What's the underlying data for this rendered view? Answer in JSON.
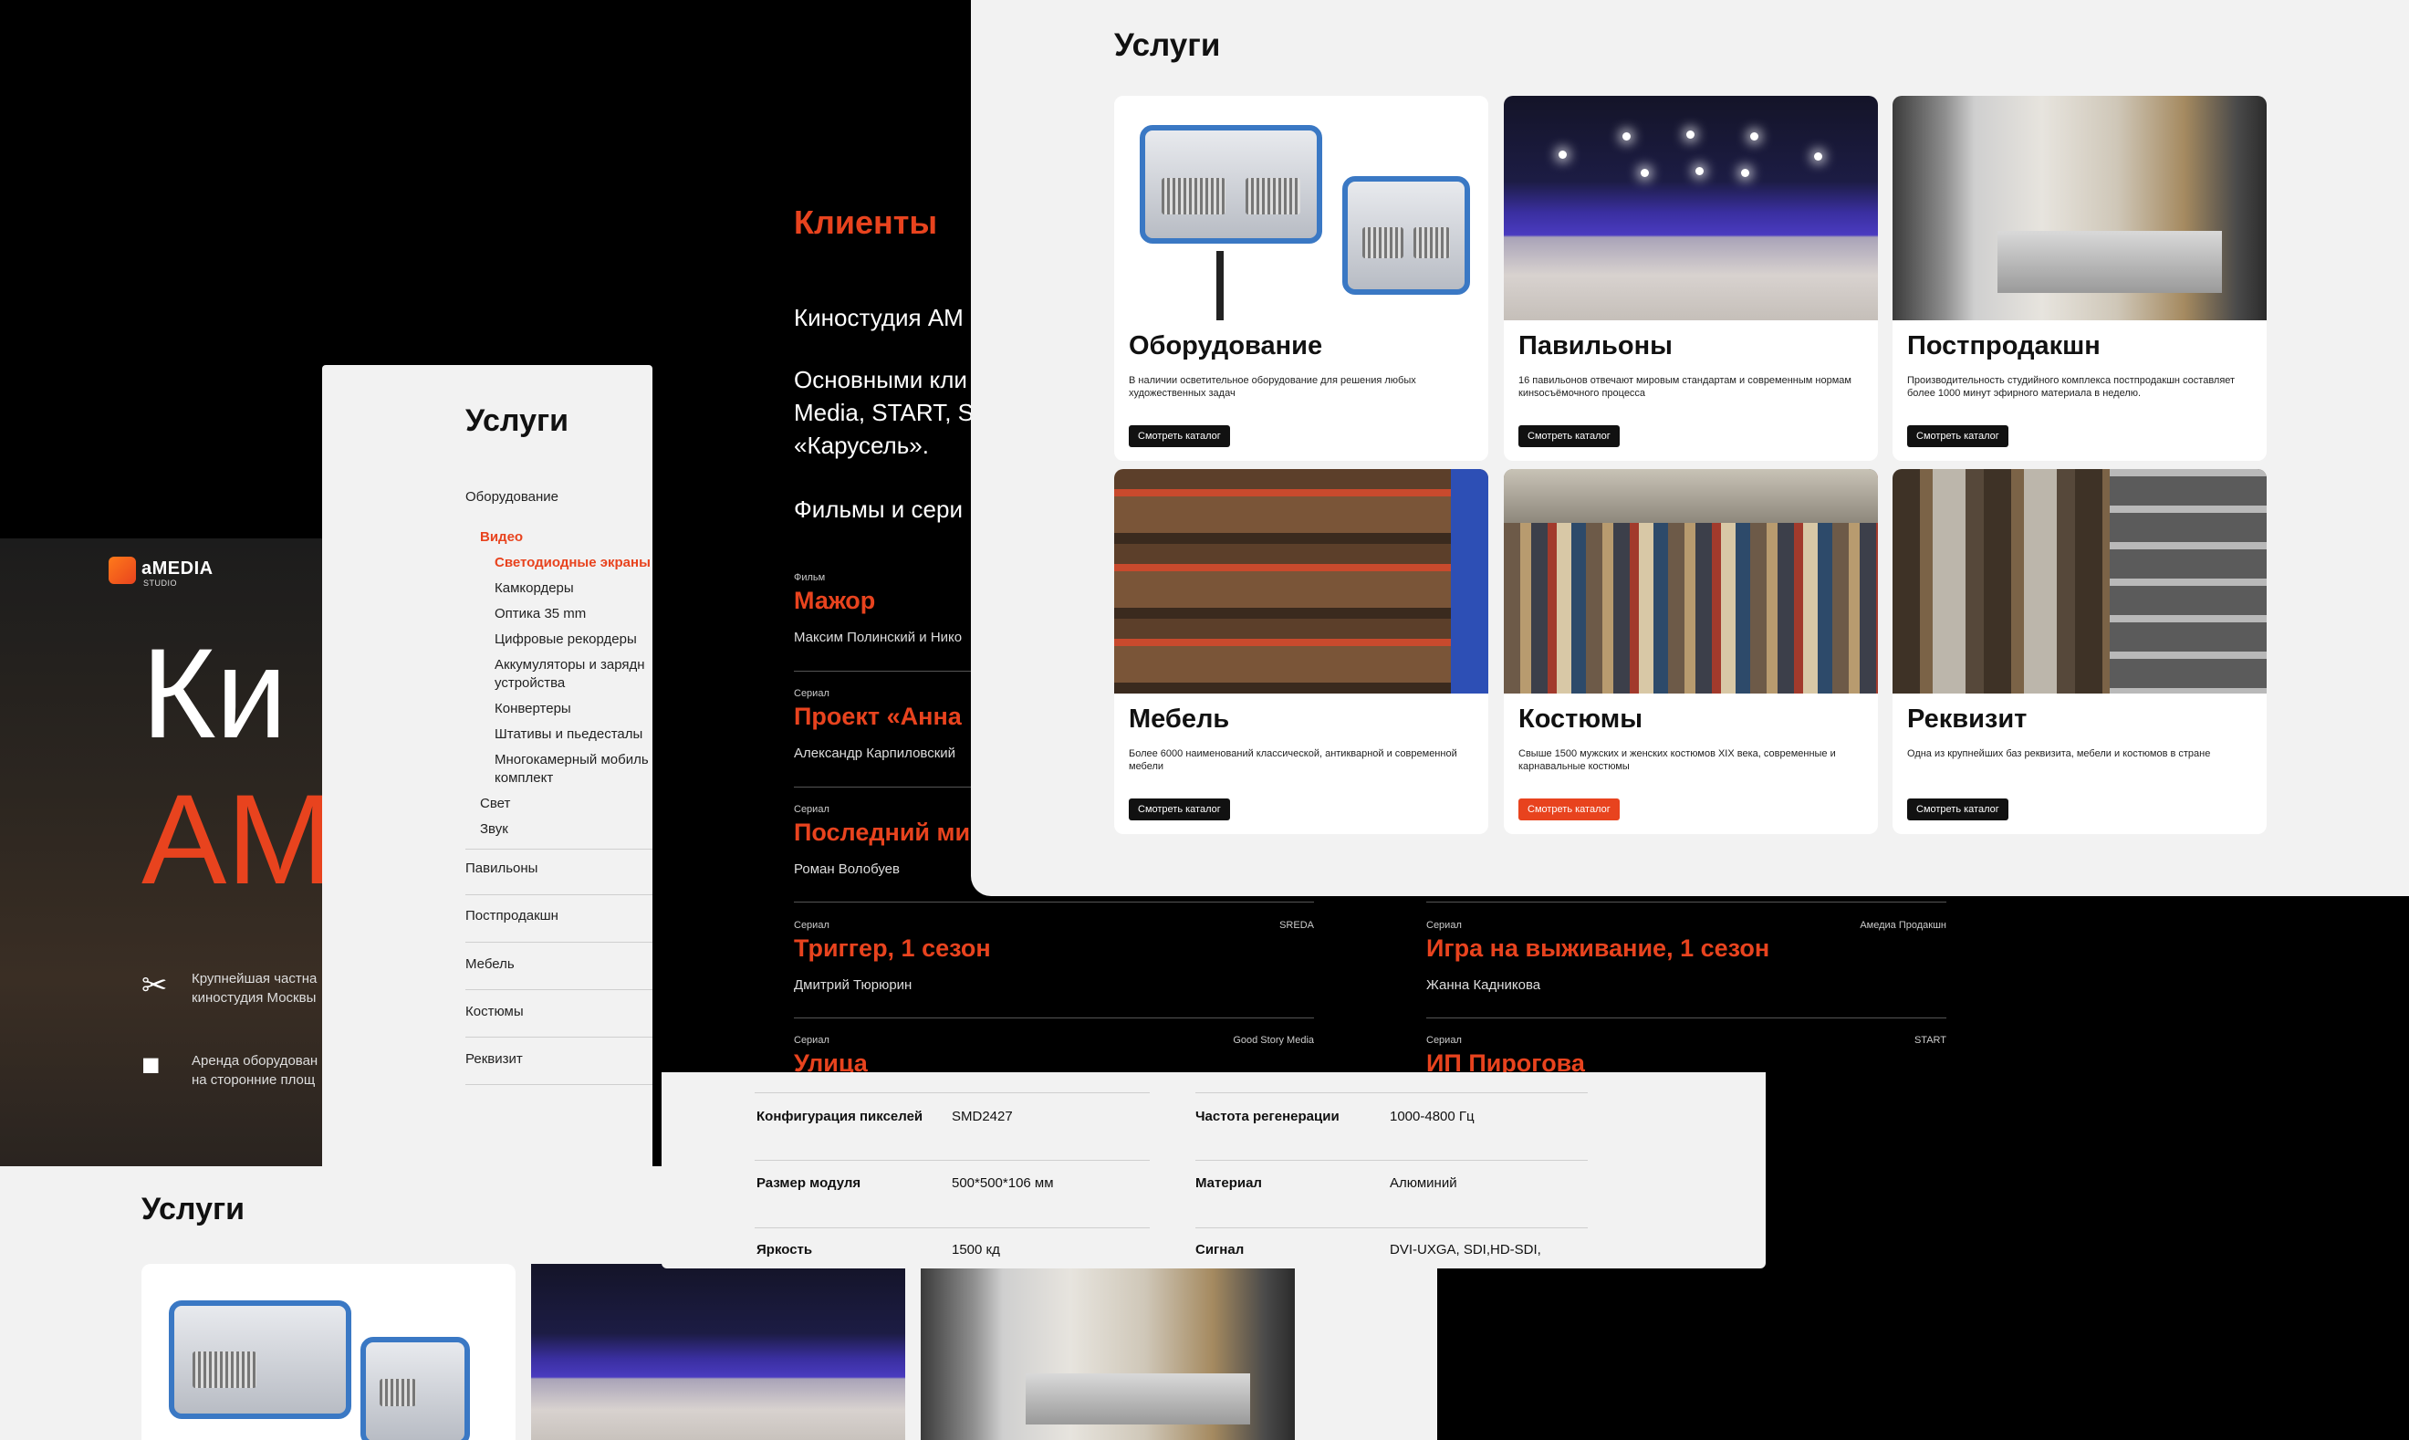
{
  "hero": {
    "logo": "aMEDIA",
    "logo_sub": "STUDIO",
    "headline_1": "Ки",
    "headline_2": "АМ",
    "features": [
      {
        "icon": "clapperboard-icon",
        "text": "Крупнейшая частна\nкиностудия Москвы"
      },
      {
        "icon": "camera-icon",
        "text": "Аренда оборудован\nна сторонние площ"
      }
    ]
  },
  "bottom_services": {
    "title": "Услуги"
  },
  "sidebar": {
    "title": "Услуги",
    "items": [
      {
        "label": "Оборудование"
      },
      {
        "label": "Видео"
      },
      {
        "label": "Светодиодные экраны"
      },
      {
        "label": "Камкордеры"
      },
      {
        "label": "Оптика 35 mm"
      },
      {
        "label": "Цифровые рекордеры"
      },
      {
        "label": "Аккумуляторы и зарядн"
      },
      {
        "label": "устройства"
      },
      {
        "label": "Конвертеры"
      },
      {
        "label": "Штативы и пьедесталы"
      },
      {
        "label": "Многокамерный мобиль"
      },
      {
        "label": "комплект"
      },
      {
        "label": "Свет"
      },
      {
        "label": "Звук"
      },
      {
        "label": "Павильоны"
      },
      {
        "label": "Постпродакшн"
      },
      {
        "label": "Мебель"
      },
      {
        "label": "Костюмы"
      },
      {
        "label": "Реквизит"
      }
    ]
  },
  "clients": {
    "title": "Клиенты",
    "para_1": "Киностудия АМ",
    "para_2_line1": "Основными кли",
    "para_2_line2": "Media, START, SI",
    "para_2_line3": "«Карусель».",
    "para_3": "Фильмы и сери",
    "items": [
      {
        "type": "Фильм",
        "name": "Мажор",
        "director": "Максим Полинский и Нико",
        "studio": ""
      },
      {
        "type": "Сериал",
        "name": "Проект «Анна",
        "director": "Александр Карпиловский",
        "studio": ""
      },
      {
        "type": "Сериал",
        "name": "Последний ми",
        "director": "Роман Волобуев",
        "studio": ""
      },
      {
        "type": "Сериал",
        "name": "Триггер, 1 сезон",
        "director": "Дмитрий Тюрюрин",
        "studio": "SREDA"
      },
      {
        "type": "Сериал",
        "name": "Игра на выживание, 1 сезон",
        "director": "Жанна Кадникова",
        "studio": "Амедиа Продакшн"
      },
      {
        "type": "Сериал",
        "name": "Улица",
        "director": "",
        "studio": "Good Story Media"
      },
      {
        "type": "Сериал",
        "name": "ИП Пирогова",
        "director": "",
        "studio": "START"
      }
    ]
  },
  "specs": {
    "rows": [
      {
        "l1": "Конфигурация пикселей",
        "v1": "SMD2427",
        "l2": "Частота регенерации",
        "v2": "1000-4800 Гц"
      },
      {
        "l1": "Размер модуля",
        "v1": "500*500*106 мм",
        "l2": "Материал",
        "v2": "Алюминий"
      },
      {
        "l1": "Яркость",
        "v1": "1500 кд",
        "l2": "Сигнал",
        "v2": "DVI-UXGA, SDI,HD-SDI,"
      }
    ]
  },
  "main": {
    "title": "Услуги",
    "cards": [
      {
        "title": "Оборудование",
        "desc": "В наличии осветительное оборудование для решения любых художественных задач",
        "button": "Смотреть каталог",
        "image": "equipment-photo"
      },
      {
        "title": "Павильоны",
        "desc": "16 павильонов отвечают мировым стандартам и современным нормам кинsocъёмочного процесса",
        "button": "Смотреть каталог",
        "image": "pavilion-photo"
      },
      {
        "title": "Постпродакшн",
        "desc": "Производительность студийного комплекса постпродакшн составляет более 1000 минут эфирного материала в неделю.",
        "button": "Смотреть каталог",
        "image": "postproduction-photo"
      },
      {
        "title": "Мебель",
        "desc": "Более 6000 наименований классической, антикварной и современной мебели",
        "button": "Смотреть каталог",
        "image": "furniture-photo"
      },
      {
        "title": "Костюмы",
        "desc": "Свыше 1500 мужских и женских костюмов XIX века, современные и карнавальные костюмы",
        "button": "Смотреть каталог",
        "image": "costumes-photo"
      },
      {
        "title": "Реквизит",
        "desc": "Одна из крупнейших баз реквизита, мебели и костюмов в стране",
        "button": "Смотреть каталог",
        "image": "props-photo"
      }
    ]
  },
  "colors": {
    "accent": "#e8431e",
    "background": "#000000",
    "panel": "#f2f2f2"
  }
}
